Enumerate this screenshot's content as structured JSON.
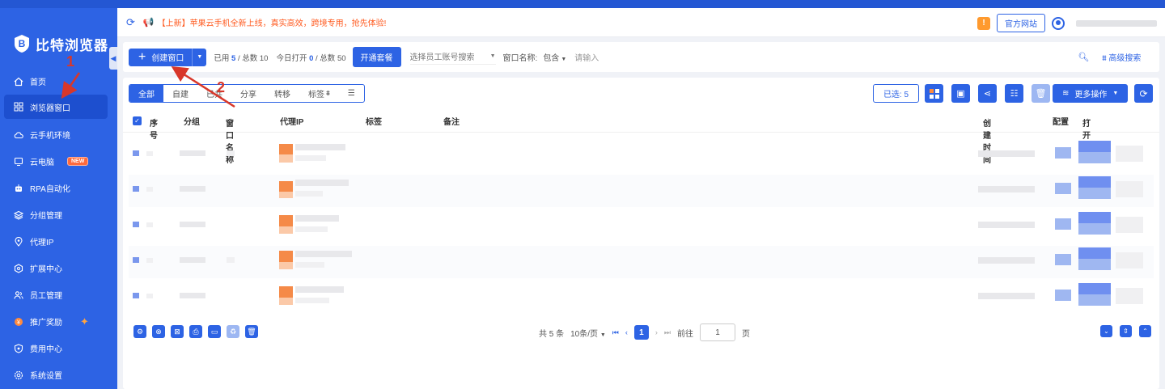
{
  "header": {
    "notice": "【上新】苹果云手机全新上线，真实高效，跨境专用，抢先体验!",
    "site_button": "官方网站",
    "warn_icon": "!"
  },
  "sidebar": {
    "brand": "比特浏览器",
    "items": [
      {
        "label": "首页",
        "icon": "home-icon"
      },
      {
        "label": "浏览器窗口",
        "icon": "grid-icon",
        "active": true
      },
      {
        "label": "云手机环境",
        "icon": "cloud-icon"
      },
      {
        "label": "云电脑",
        "icon": "computer-icon",
        "badge": "NEW"
      },
      {
        "label": "RPA自动化",
        "icon": "robot-icon"
      },
      {
        "label": "分组管理",
        "icon": "layers-icon"
      },
      {
        "label": "代理IP",
        "icon": "location-icon"
      },
      {
        "label": "扩展中心",
        "icon": "hexagon-icon"
      },
      {
        "label": "员工管理",
        "icon": "users-icon"
      },
      {
        "label": "推广奖励",
        "icon": "gift-icon"
      },
      {
        "label": "费用中心",
        "icon": "shield-icon"
      },
      {
        "label": "系统设置",
        "icon": "gear-icon"
      }
    ]
  },
  "toolbar": {
    "create_label": "创建窗口",
    "used_label": "已用",
    "used": "5",
    "total_label": "/ 总数 10",
    "opened_label": "今日打开",
    "opened": "0",
    "opened_total": "/ 总数 50",
    "package_button": "开通套餐",
    "employee_placeholder": "选择员工账号搜索",
    "name_label": "窗口名称:",
    "match_mode": "包含",
    "search_placeholder": "请输入",
    "advanced": "高级搜索"
  },
  "tabs": [
    "全部",
    "自建",
    "已共",
    "分享",
    "转移",
    "标签"
  ],
  "actions": {
    "selected": "已选: 5",
    "more": "更多操作"
  },
  "table": {
    "columns": [
      "序号",
      "分组",
      "窗口名称",
      "代理IP",
      "标签",
      "备注",
      "创建时间",
      "配置",
      "打开"
    ]
  },
  "pagination": {
    "total": "共 5 条",
    "page_size": "10条/页",
    "current": "1",
    "goto_label": "前往",
    "goto_value": "1",
    "page_unit": "页"
  },
  "annotations": [
    "1",
    "2"
  ],
  "colors": {
    "accent": "#2d63e4",
    "notice": "#ff5a1f",
    "annotation": "#d8372a"
  }
}
